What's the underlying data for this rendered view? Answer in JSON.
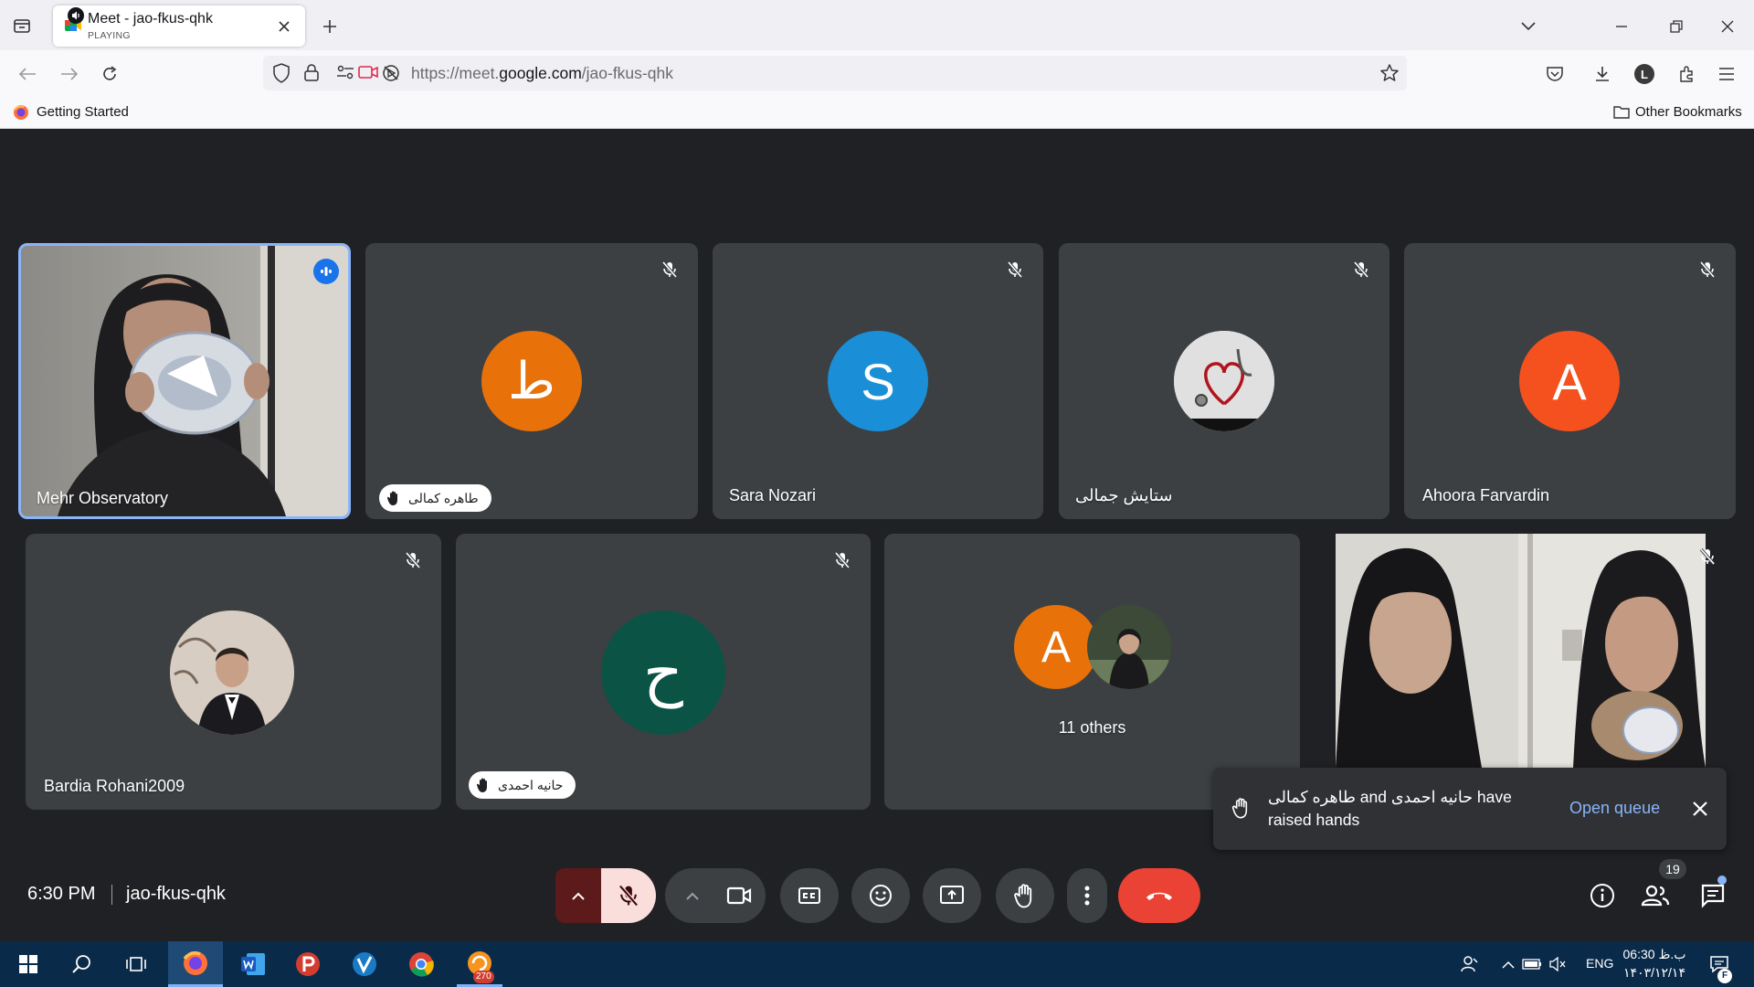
{
  "browser": {
    "tab": {
      "title": "Meet - jao-fkus-qhk",
      "status": "PLAYING"
    },
    "url": {
      "prefix": "https://meet.",
      "domain": "google.com",
      "path": "/jao-fkus-qhk"
    },
    "bookmarks": {
      "left": "Getting Started",
      "right": "Other Bookmarks"
    },
    "profile_initial": "L"
  },
  "meet": {
    "participants": [
      {
        "name": "Mehr Observatory"
      },
      {
        "name": "طاهره کمالی",
        "avatar_letter": "ط",
        "avatar_color": "#e8710a"
      },
      {
        "name": "Sara Nozari",
        "avatar_letter": "S",
        "avatar_color": "#1a8fd8"
      },
      {
        "name": "ستایش جمالی"
      },
      {
        "name": "Ahoora Farvardin",
        "avatar_letter": "A",
        "avatar_color": "#f4511e"
      },
      {
        "name": "Bardia Rohani2009"
      },
      {
        "name": "حانیه احمدی",
        "avatar_letter": "ح",
        "avatar_color": "#0b5345"
      },
      {
        "others_label": "11 others",
        "avatar_letter": "A",
        "avatar_color": "#e8710a"
      }
    ],
    "toast": {
      "message": "طاهره کمالی and حانیه احمدی have raised hands",
      "action": "Open queue"
    },
    "footer": {
      "time": "6:30 PM",
      "code": "jao-fkus-qhk",
      "people_count": "19"
    }
  },
  "taskbar": {
    "lang": "ENG",
    "time": "06:30 ب.ظ",
    "date": "۱۴۰۳/۱۲/۱۴",
    "notif_badge": "270",
    "notif_letter": "F"
  },
  "colors": {
    "meet_bg": "#202124",
    "tile_bg": "#3c4043",
    "active_border": "#8ab4f8",
    "hangup": "#ea4335",
    "mic_off": "#f9dedc",
    "accent_link": "#8ab4f8"
  }
}
